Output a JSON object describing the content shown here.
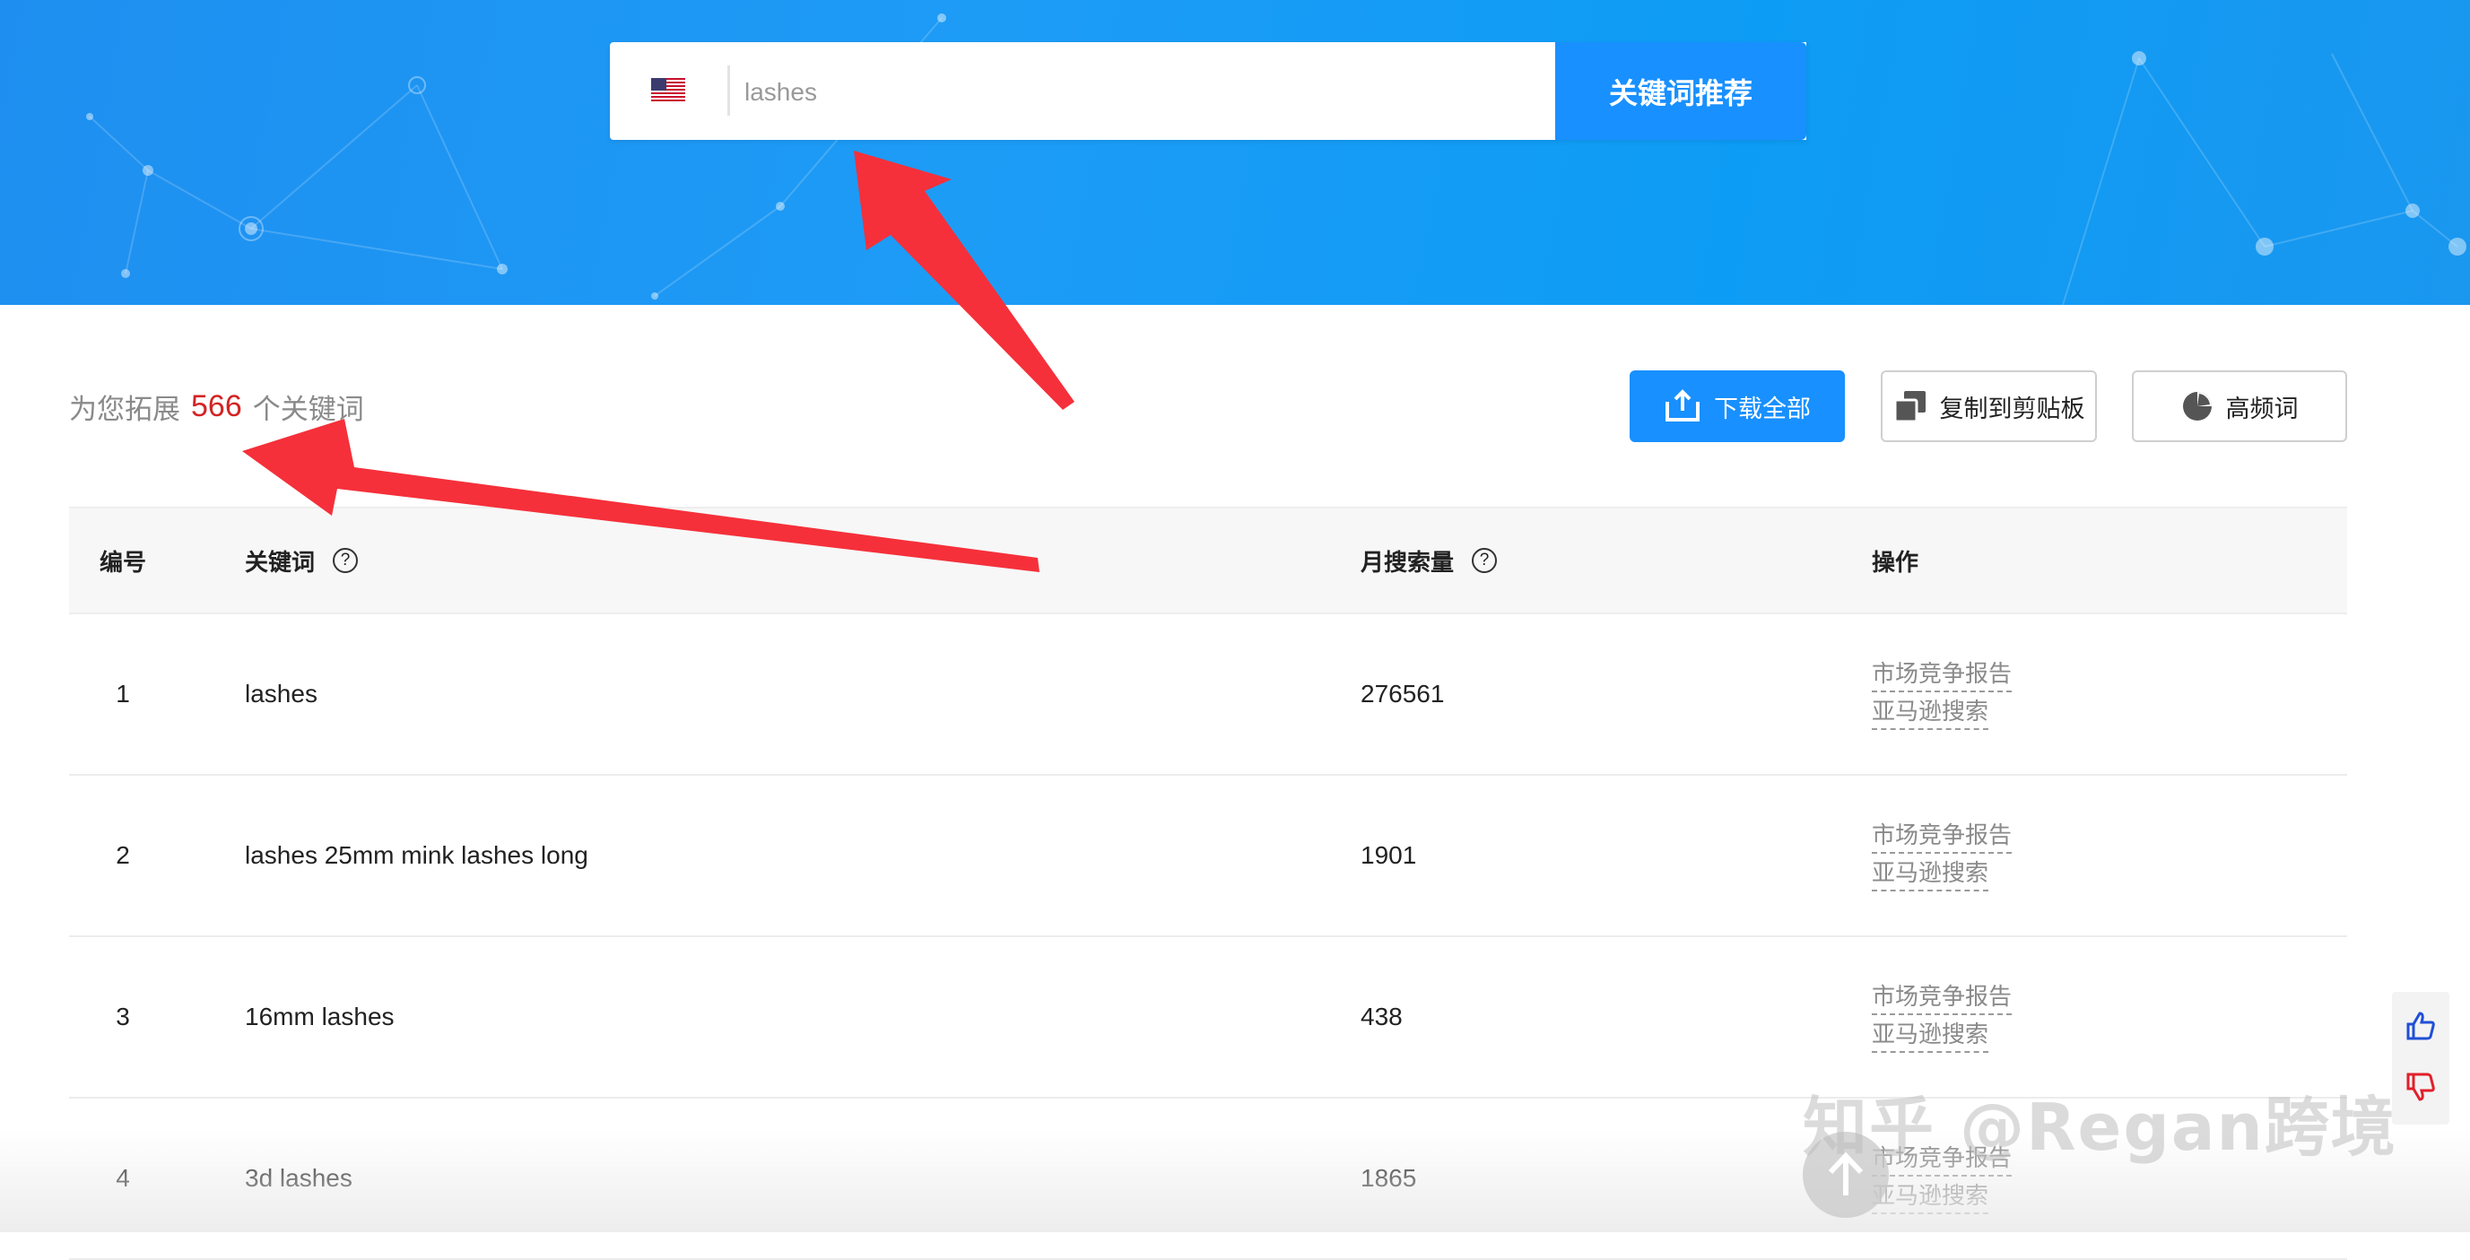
{
  "search": {
    "country_flag": "us-flag-icon",
    "input_value": "lashes",
    "button_label": "关键词推荐"
  },
  "summary": {
    "prefix": "为您拓展",
    "count": "566",
    "suffix": "个关键词"
  },
  "actions": {
    "download_label": "下载全部",
    "copy_label": "复制到剪贴板",
    "frequent_label": "高频词"
  },
  "table": {
    "headers": {
      "no": "编号",
      "keyword": "关键词",
      "volume": "月搜索量",
      "operation": "操作"
    },
    "rows": [
      {
        "no": "1",
        "keyword": "lashes",
        "volume": "276561",
        "op1": "市场竞争报告",
        "op2": "亚马逊搜索"
      },
      {
        "no": "2",
        "keyword": "lashes 25mm mink lashes long",
        "volume": "1901",
        "op1": "市场竞争报告",
        "op2": "亚马逊搜索"
      },
      {
        "no": "3",
        "keyword": "16mm lashes",
        "volume": "438",
        "op1": "市场竞争报告",
        "op2": "亚马逊搜索"
      },
      {
        "no": "4",
        "keyword": "3d lashes",
        "volume": "1865",
        "op1": "市场竞争报告",
        "op2": "亚马逊搜索"
      }
    ]
  },
  "watermark": "知乎 @Regan跨境",
  "colors": {
    "accent": "#1890ff",
    "count_red": "#d32323",
    "annotation_red": "#f5303a"
  }
}
